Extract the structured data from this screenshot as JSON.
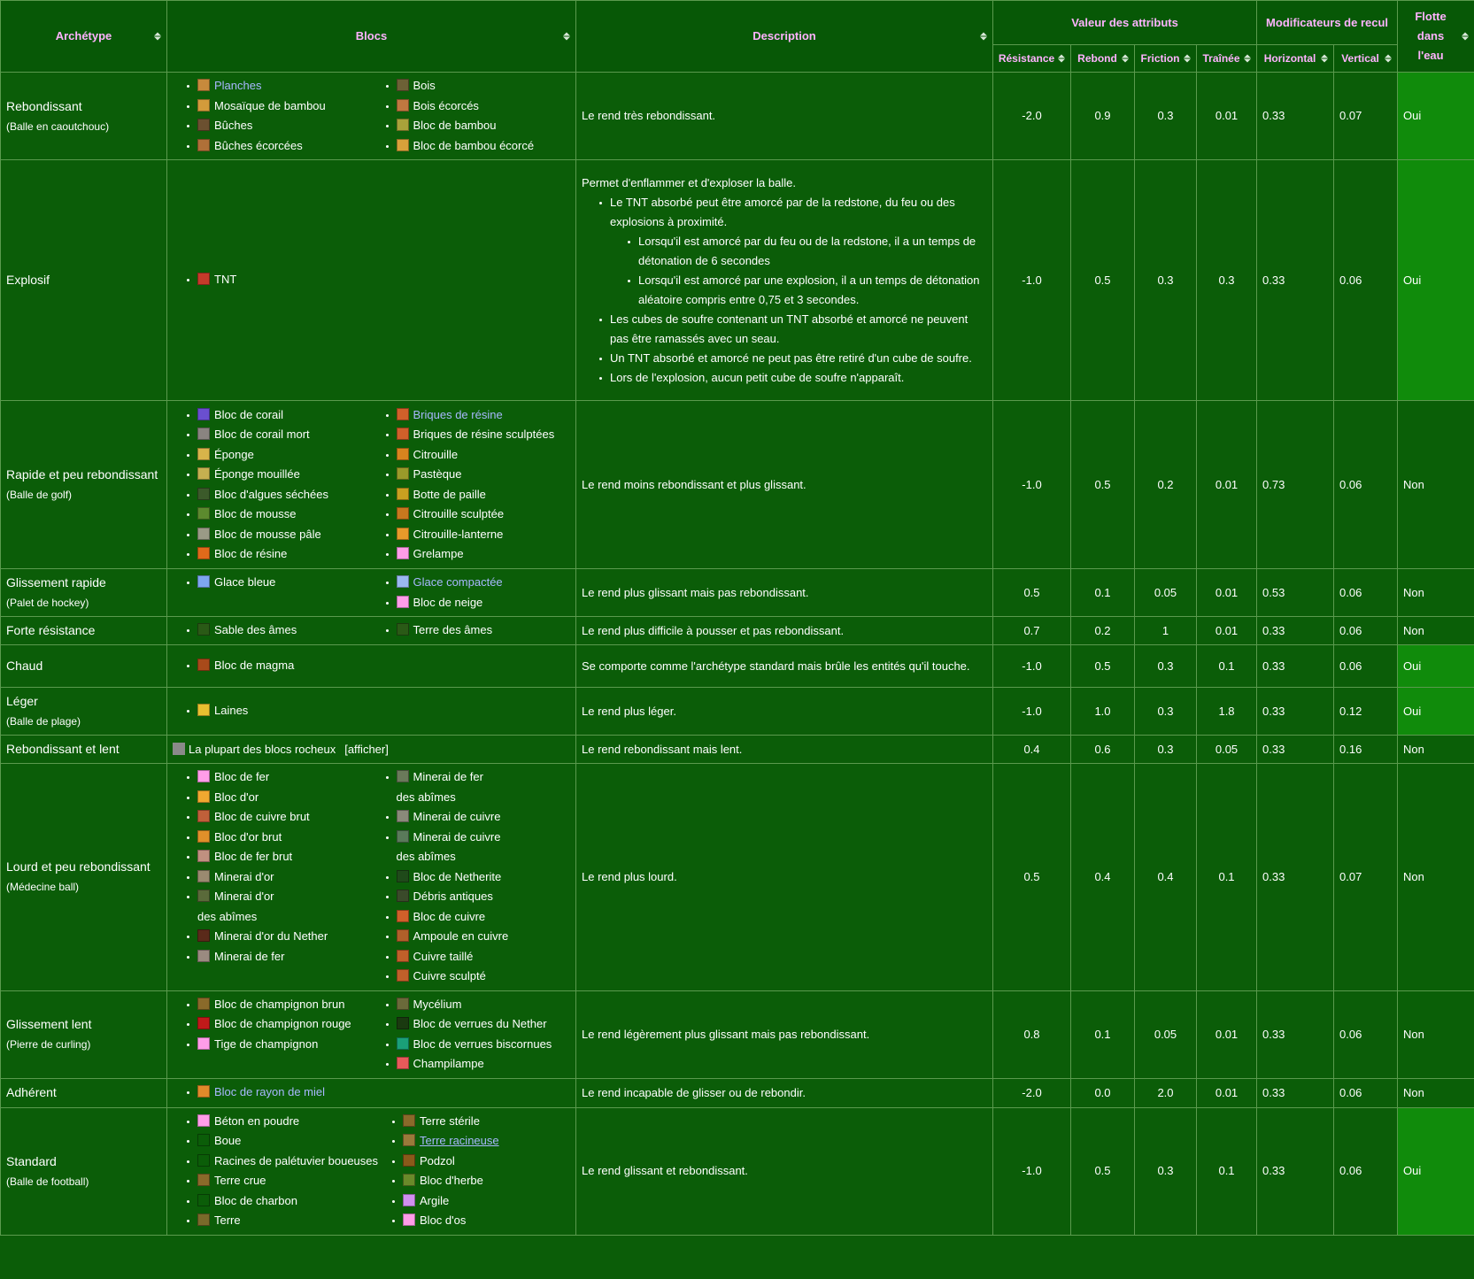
{
  "headers": {
    "archetype": "Archétype",
    "blocks": "Blocs",
    "description": "Description",
    "attr_group": "Valeur des attributs",
    "recoil_group": "Modificateurs de recul",
    "floats": "Flotte dans l'eau",
    "resistance": "Résistance",
    "rebound": "Rebond",
    "friction": "Friction",
    "drag": "Traînée",
    "horizontal": "Horizontal",
    "vertical": "Vertical"
  },
  "rows": [
    {
      "name": "Rebondissant",
      "sub": "(Balle en caoutchouc)",
      "col1": [
        {
          "t": "Planches",
          "c": "#c78a3c",
          "link": true
        },
        {
          "t": "Mosaïque de bambou",
          "c": "#d39b3b"
        },
        {
          "t": "Bûches",
          "c": "#6b5030"
        },
        {
          "t": "Bûches écorcées",
          "c": "#b07038"
        }
      ],
      "col2": [
        {
          "t": "Bois",
          "c": "#6d6136"
        },
        {
          "t": "Bois écorcés",
          "c": "#c07840"
        },
        {
          "t": "Bloc de bambou",
          "c": "#a9a23a"
        },
        {
          "t": "Bloc de bambou écorcé",
          "c": "#d8a13a"
        }
      ],
      "desc": "Le rend très rebondissant.",
      "v": [
        "-2.0",
        "0.9",
        "0.3",
        "0.01",
        "0.33",
        "0.07"
      ],
      "float": "Oui"
    },
    {
      "name": "Explosif",
      "sub": "",
      "col1": [
        {
          "t": "TNT",
          "c": "#c53a2a"
        }
      ],
      "col2": [],
      "desc_intro": "Permet d'enflammer et d'exploser la balle.",
      "desc_b1": "Le TNT absorbé peut être amorcé par de la redstone, du feu ou des explosions à proximité.",
      "desc_b1a": "Lorsqu'il est amorcé par du feu ou de la redstone, il a un temps de détonation de 6 secondes",
      "desc_b1b": "Lorsqu'il est amorcé par une explosion, il a un temps de détonation aléatoire compris entre 0,75 et 3 secondes.",
      "desc_b2": "Les cubes de soufre contenant un TNT absorbé et amorcé ne peuvent pas être ramassés avec un seau.",
      "desc_b3": "Un TNT absorbé et amorcé ne peut pas être retiré d'un cube de soufre.",
      "desc_b4": "Lors de l'explosion, aucun petit cube de soufre n'apparaît.",
      "v": [
        "-1.0",
        "0.5",
        "0.3",
        "0.3",
        "0.33",
        "0.06"
      ],
      "float": "Oui"
    },
    {
      "name": "Rapide et peu rebondissant",
      "sub": "(Balle de golf)",
      "col1": [
        {
          "t": "Bloc de corail",
          "c": "#6a4fd0"
        },
        {
          "t": "Bloc de corail mort",
          "c": "#8a8480"
        },
        {
          "t": "Éponge",
          "c": "#d8b44a"
        },
        {
          "t": "Éponge mouillée",
          "c": "#c5b050"
        },
        {
          "t": "Bloc d'algues séchées",
          "c": "#3b5a2a"
        },
        {
          "t": "Bloc de mousse",
          "c": "#5c8a2e"
        },
        {
          "t": "Bloc de mousse pâle",
          "c": "#9a9a86"
        },
        {
          "t": "Bloc de résine",
          "c": "#e06a1a"
        }
      ],
      "col2": [
        {
          "t": "Briques de résine",
          "c": "#d0602a",
          "link": true
        },
        {
          "t": "Briques de résine sculptées",
          "c": "#d0602a"
        },
        {
          "t": "Citrouille",
          "c": "#d8841e"
        },
        {
          "t": "Pastèque",
          "c": "#9a9a2a"
        },
        {
          "t": "Botte de paille",
          "c": "#c8a020"
        },
        {
          "t": "Citrouille sculptée",
          "c": "#c8781e"
        },
        {
          "t": "Citrouille-lanterne",
          "c": "#e89a2a"
        },
        {
          "t": "Grelampe",
          "c": "#ff9de8"
        }
      ],
      "desc": "Le rend moins rebondissant et plus glissant.",
      "v": [
        "-1.0",
        "0.5",
        "0.2",
        "0.01",
        "0.73",
        "0.06"
      ],
      "float": "Non"
    },
    {
      "name": "Glissement rapide",
      "sub": "(Palet de hockey)",
      "col1": [
        {
          "t": "Glace bleue",
          "c": "#7da6f0"
        }
      ],
      "col2": [
        {
          "t": "Glace compactée",
          "c": "#9ab8f0",
          "link": true
        },
        {
          "t": "Bloc de neige",
          "c": "#ff9de8"
        }
      ],
      "desc": "Le rend plus glissant mais pas rebondissant.",
      "v": [
        "0.5",
        "0.1",
        "0.05",
        "0.01",
        "0.53",
        "0.06"
      ],
      "float": "Non"
    },
    {
      "name": "Forte résistance",
      "sub": "",
      "col1": [
        {
          "t": "Sable des âmes",
          "c": "#2a5a16"
        }
      ],
      "col2": [
        {
          "t": "Terre des âmes",
          "c": "#2a5a16"
        }
      ],
      "desc": "Le rend plus difficile à pousser et pas rebondissant.",
      "v": [
        "0.7",
        "0.2",
        "1",
        "0.01",
        "0.33",
        "0.06"
      ],
      "float": "Non"
    },
    {
      "name": "Chaud",
      "sub": "",
      "col1": [
        {
          "t": "Bloc de magma",
          "c": "#a84a1a"
        }
      ],
      "col2": [],
      "desc": "Se comporte comme l'archétype standard mais brûle les entités qu'il touche.",
      "v": [
        "-1.0",
        "0.5",
        "0.3",
        "0.1",
        "0.33",
        "0.06"
      ],
      "float": "Oui"
    },
    {
      "name": "Léger",
      "sub": "(Balle de plage)",
      "col1": [
        {
          "t": "Laines",
          "c": "#e8c030"
        }
      ],
      "col2": [],
      "desc": "Le rend plus léger.",
      "v": [
        "-1.0",
        "1.0",
        "0.3",
        "1.8",
        "0.33",
        "0.12"
      ],
      "float": "Oui"
    },
    {
      "name": "Rebondissant et lent",
      "sub": "",
      "rock": "La plupart des blocs rocheux",
      "show": "[afficher]",
      "desc": "Le rend rebondissant mais lent.",
      "v": [
        "0.4",
        "0.6",
        "0.3",
        "0.05",
        "0.33",
        "0.16"
      ],
      "float": "Non"
    },
    {
      "name": "Lourd et peu rebondissant",
      "sub": "(Médecine ball)",
      "col1": [
        {
          "t": "Bloc de fer",
          "c": "#ff9de8"
        },
        {
          "t": "Bloc d'or",
          "c": "#f0a830"
        },
        {
          "t": "Bloc de cuivre brut",
          "c": "#c0603a"
        },
        {
          "t": "Bloc d'or brut",
          "c": "#e0902a"
        },
        {
          "t": "Bloc de fer brut",
          "c": "#c09080"
        },
        {
          "t": "Minerai d'or",
          "c": "#9a8a70"
        },
        {
          "t": "Minerai d'or",
          "c": "#5a6a3a",
          "cont": "des abîmes"
        },
        {
          "t": "Minerai d'or du Nether",
          "c": "#5a2a1a"
        },
        {
          "t": "Minerai de fer",
          "c": "#9a8a80"
        }
      ],
      "col2": [
        {
          "t": "Minerai de fer",
          "c": "#6a7a5a",
          "cont": "des abîmes"
        },
        {
          "t": "Minerai de cuivre",
          "c": "#8a8a7a"
        },
        {
          "t": "Minerai de cuivre",
          "c": "#5a7a5a",
          "cont": "des abîmes"
        },
        {
          "t": "Bloc de Netherite",
          "c": "#1f4a1a"
        },
        {
          "t": "Débris antiques",
          "c": "#3a4a2a"
        },
        {
          "t": "Bloc de cuivre",
          "c": "#d0602a"
        },
        {
          "t": "Ampoule en cuivre",
          "c": "#b0602a"
        },
        {
          "t": "Cuivre taillé",
          "c": "#c0602a"
        },
        {
          "t": "Cuivre sculpté",
          "c": "#c0602a"
        }
      ],
      "desc": "Le rend plus lourd.",
      "v": [
        "0.5",
        "0.4",
        "0.4",
        "0.1",
        "0.33",
        "0.07"
      ],
      "float": "Non"
    },
    {
      "name": "Glissement lent",
      "sub": "(Pierre de curling)",
      "col1": [
        {
          "t": "Bloc de champignon brun",
          "c": "#8a6a2a"
        },
        {
          "t": "Bloc de champignon rouge",
          "c": "#c01a1a"
        },
        {
          "t": "Tige de champignon",
          "c": "#ff9de8"
        }
      ],
      "col2": [
        {
          "t": "Mycélium",
          "c": "#6a6a3a"
        },
        {
          "t": "Bloc de verrues du Nether",
          "c": "#1a3a10"
        },
        {
          "t": "Bloc de verrues biscornues",
          "c": "#1aa078"
        },
        {
          "t": "Champilampe",
          "c": "#e85a5a"
        }
      ],
      "desc": "Le rend légèrement plus glissant mais pas rebondissant.",
      "v": [
        "0.8",
        "0.1",
        "0.05",
        "0.01",
        "0.33",
        "0.06"
      ],
      "float": "Non"
    },
    {
      "name": "Adhérent",
      "sub": "",
      "col1": [
        {
          "t": "Bloc de rayon de miel",
          "c": "#e08a2a",
          "link": true
        }
      ],
      "col2": [],
      "desc": "Le rend incapable de glisser ou de rebondir.",
      "v": [
        "-2.0",
        "0.0",
        "2.0",
        "0.01",
        "0.33",
        "0.06"
      ],
      "float": "Non"
    },
    {
      "name": "Standard",
      "sub": "(Balle de football)",
      "col1": [
        {
          "t": "Béton en poudre",
          "c": "#ff9de8"
        },
        {
          "t": "Boue",
          "c": "#0b5d08"
        },
        {
          "t": "Racines de palétuvier boueuses",
          "c": "#0b5d08"
        },
        {
          "t": "Terre crue",
          "c": "#8a6a2a"
        },
        {
          "t": "Bloc de charbon",
          "c": "#0b5d08"
        },
        {
          "t": "Terre",
          "c": "#7a6a2a"
        }
      ],
      "col2": [
        {
          "t": "Terre stérile",
          "c": "#8a6a2a"
        },
        {
          "t": "Terre racineuse",
          "c": "#9a7a3a",
          "link": true,
          "u": true
        },
        {
          "t": "Podzol",
          "c": "#8a5a1a"
        },
        {
          "t": "Bloc d'herbe",
          "c": "#6a8a2a"
        },
        {
          "t": "Argile",
          "c": "#d090f0"
        },
        {
          "t": "Bloc d'os",
          "c": "#ff9de8"
        }
      ],
      "desc": "Le rend glissant et rebondissant.",
      "v": [
        "-1.0",
        "0.5",
        "0.3",
        "0.1",
        "0.33",
        "0.06"
      ],
      "float": "Oui"
    }
  ]
}
